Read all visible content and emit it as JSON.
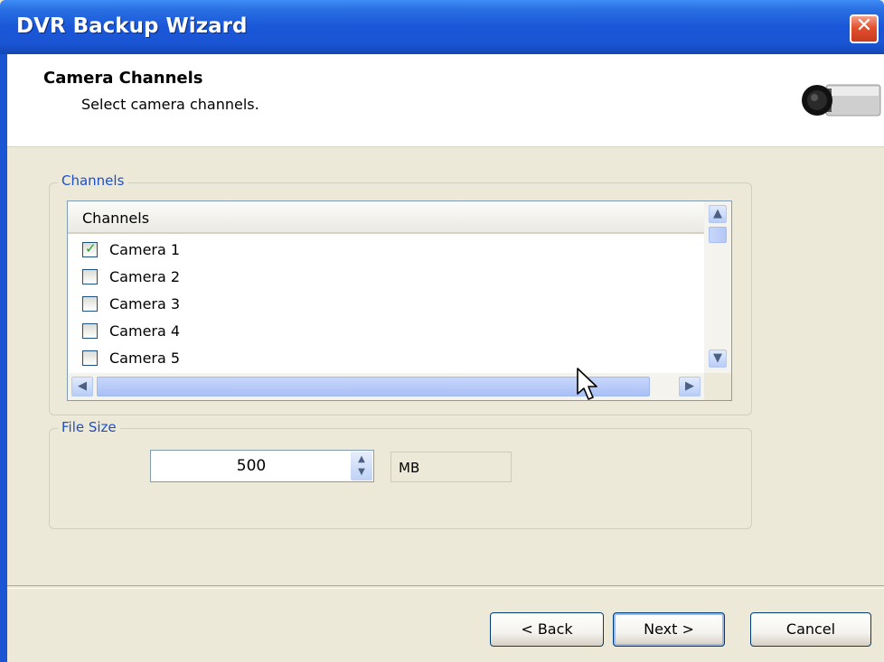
{
  "window": {
    "title": "DVR Backup Wizard",
    "close_glyph": "✕"
  },
  "header": {
    "title": "Camera Channels",
    "subtitle": "Select camera channels.",
    "icon": "camera-icon"
  },
  "channels_group": {
    "label": "Channels",
    "column_header": "Channels",
    "items": [
      {
        "label": "Camera 1",
        "checked": true
      },
      {
        "label": "Camera 2",
        "checked": false
      },
      {
        "label": "Camera 3",
        "checked": false
      },
      {
        "label": "Camera 4",
        "checked": false
      },
      {
        "label": "Camera 5",
        "checked": false
      }
    ]
  },
  "file_size_group": {
    "label": "File Size",
    "value": "500",
    "unit": "MB"
  },
  "buttons": {
    "back": "< Back",
    "next": "Next >",
    "cancel": "Cancel"
  },
  "colors": {
    "title_bar": "#1a55d4",
    "group_label": "#1d4fc8",
    "face": "#ece9d8",
    "checkmark": "#21a121",
    "close_button": "#e2512e"
  }
}
